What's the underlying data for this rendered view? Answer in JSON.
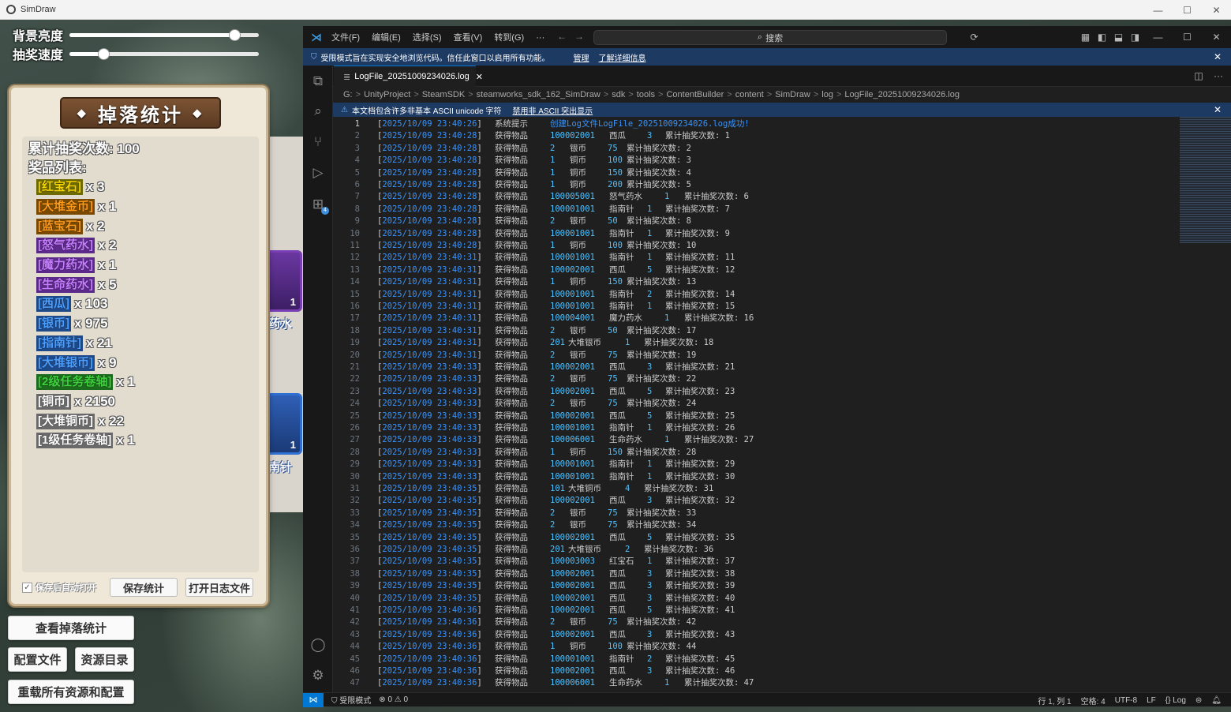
{
  "host": {
    "title": "SimDraw",
    "sliders": [
      {
        "label": "背景亮度",
        "value": 0.87
      },
      {
        "label": "抽奖速度",
        "value": 0.18
      }
    ],
    "drop_panel": {
      "title": "掉落统计",
      "total_label": "累计抽奖次数: 100",
      "list_label": "奖品列表:",
      "prizes": [
        {
          "name": "[红宝石]",
          "count": "x 3",
          "color": "#f5d400",
          "bg": "#6d6a00"
        },
        {
          "name": "[大堆金币]",
          "count": "x 1",
          "color": "#ff9a1a",
          "bg": "#7a4a00"
        },
        {
          "name": "[蓝宝石]",
          "count": "x 2",
          "color": "#ff9a1a",
          "bg": "#7a4a00"
        },
        {
          "name": "[怒气药水]",
          "count": "x 2",
          "color": "#c77dff",
          "bg": "#5b2a8a"
        },
        {
          "name": "[魔力药水]",
          "count": "x 1",
          "color": "#c77dff",
          "bg": "#5b2a8a"
        },
        {
          "name": "[生命药水]",
          "count": "x 5",
          "color": "#c77dff",
          "bg": "#5b2a8a"
        },
        {
          "name": "[西瓜]",
          "count": "x 103",
          "color": "#4d9fff",
          "bg": "#1f4a8a"
        },
        {
          "name": "[银币]",
          "count": "x 975",
          "color": "#4d9fff",
          "bg": "#1f4a8a"
        },
        {
          "name": "[指南针]",
          "count": "x 21",
          "color": "#4d9fff",
          "bg": "#1f4a8a"
        },
        {
          "name": "[大堆银币]",
          "count": "x 9",
          "color": "#4d9fff",
          "bg": "#1f4a8a"
        },
        {
          "name": "[2级任务卷轴]",
          "count": "x 1",
          "color": "#3fd23f",
          "bg": "#1d6b1d"
        },
        {
          "name": "[铜币]",
          "count": "x 2150",
          "color": "#ffffff",
          "bg": "#6a6a6a"
        },
        {
          "name": "[大堆铜币]",
          "count": "x 22",
          "color": "#ffffff",
          "bg": "#6a6a6a"
        },
        {
          "name": "[1级任务卷轴]",
          "count": "x 1",
          "color": "#ffffff",
          "bg": "#6a6a6a"
        }
      ],
      "auto_open_label": "保存后自动打开",
      "save_label": "保存统计",
      "open_log_label": "打开日志文件"
    },
    "card_labels": [
      "药水",
      "南针"
    ],
    "card_counts": [
      "1",
      "1"
    ],
    "buttons": {
      "view_stats": "查看掉落统计",
      "config_file": "配置文件",
      "resource_dir": "资源目录",
      "reload_all": "重载所有资源和配置"
    }
  },
  "vscode": {
    "menu": [
      "文件(F)",
      "编辑(E)",
      "选择(S)",
      "查看(V)",
      "转到(G)",
      "···"
    ],
    "search_placeholder": "搜索",
    "restricted_text": "受限模式旨在实现安全地浏览代码。信任此窗口以启用所有功能。",
    "restricted_manage": "管理",
    "restricted_learn": "了解详细信息",
    "tab_label": "LogFile_20251009234026.log",
    "breadcrumb": [
      "G:",
      "UnityProject",
      "SteamSDK",
      "steamworks_sdk_162_SimDraw",
      "sdk",
      "tools",
      "ContentBuilder",
      "content",
      "SimDraw",
      "log",
      "LogFile_20251009234026.log"
    ],
    "unicode_warning": "本文档包含许多非基本 ASCII unicode 字符",
    "unicode_disable": "禁用非 ASCII 突出显示",
    "lines": [
      {
        "n": "1",
        "ts": "2025/10/09 23:40:26",
        "kind": "系统提示",
        "msg": "创建Log文件LogFile_20251009234026.log成功!"
      },
      {
        "n": "2",
        "ts": "2025/10/09 23:40:28",
        "kind": "获得物品",
        "id": "100002001",
        "name": "西瓜",
        "qty": "3",
        "total": "累计抽奖次数: 1"
      },
      {
        "n": "3",
        "ts": "2025/10/09 23:40:28",
        "kind": "获得物品",
        "id": "2",
        "name": "银币",
        "qty": "75",
        "total": "累计抽奖次数: 2"
      },
      {
        "n": "4",
        "ts": "2025/10/09 23:40:28",
        "kind": "获得物品",
        "id": "1",
        "name": "铜币",
        "qty": "100",
        "total": "累计抽奖次数: 3"
      },
      {
        "n": "5",
        "ts": "2025/10/09 23:40:28",
        "kind": "获得物品",
        "id": "1",
        "name": "铜币",
        "qty": "150",
        "total": "累计抽奖次数: 4"
      },
      {
        "n": "6",
        "ts": "2025/10/09 23:40:28",
        "kind": "获得物品",
        "id": "1",
        "name": "铜币",
        "qty": "200",
        "total": "累计抽奖次数: 5"
      },
      {
        "n": "7",
        "ts": "2025/10/09 23:40:28",
        "kind": "获得物品",
        "id": "100005001",
        "name": "怒气药水",
        "qty": "1",
        "total": "累计抽奖次数: 6"
      },
      {
        "n": "8",
        "ts": "2025/10/09 23:40:28",
        "kind": "获得物品",
        "id": "100001001",
        "name": "指南针",
        "qty": "1",
        "total": "累计抽奖次数: 7"
      },
      {
        "n": "9",
        "ts": "2025/10/09 23:40:28",
        "kind": "获得物品",
        "id": "2",
        "name": "银币",
        "qty": "50",
        "total": "累计抽奖次数: 8"
      },
      {
        "n": "10",
        "ts": "2025/10/09 23:40:28",
        "kind": "获得物品",
        "id": "100001001",
        "name": "指南针",
        "qty": "1",
        "total": "累计抽奖次数: 9"
      },
      {
        "n": "11",
        "ts": "2025/10/09 23:40:28",
        "kind": "获得物品",
        "id": "1",
        "name": "铜币",
        "qty": "100",
        "total": "累计抽奖次数: 10"
      },
      {
        "n": "12",
        "ts": "2025/10/09 23:40:31",
        "kind": "获得物品",
        "id": "100001001",
        "name": "指南针",
        "qty": "1",
        "total": "累计抽奖次数: 11"
      },
      {
        "n": "13",
        "ts": "2025/10/09 23:40:31",
        "kind": "获得物品",
        "id": "100002001",
        "name": "西瓜",
        "qty": "5",
        "total": "累计抽奖次数: 12"
      },
      {
        "n": "14",
        "ts": "2025/10/09 23:40:31",
        "kind": "获得物品",
        "id": "1",
        "name": "铜币",
        "qty": "150",
        "total": "累计抽奖次数: 13"
      },
      {
        "n": "15",
        "ts": "2025/10/09 23:40:31",
        "kind": "获得物品",
        "id": "100001001",
        "name": "指南针",
        "qty": "2",
        "total": "累计抽奖次数: 14"
      },
      {
        "n": "16",
        "ts": "2025/10/09 23:40:31",
        "kind": "获得物品",
        "id": "100001001",
        "name": "指南针",
        "qty": "1",
        "total": "累计抽奖次数: 15"
      },
      {
        "n": "17",
        "ts": "2025/10/09 23:40:31",
        "kind": "获得物品",
        "id": "100004001",
        "name": "魔力药水",
        "qty": "1",
        "total": "累计抽奖次数: 16"
      },
      {
        "n": "18",
        "ts": "2025/10/09 23:40:31",
        "kind": "获得物品",
        "id": "2",
        "name": "银币",
        "qty": "50",
        "total": "累计抽奖次数: 17"
      },
      {
        "n": "19",
        "ts": "2025/10/09 23:40:31",
        "kind": "获得物品",
        "id": "201",
        "name": "大堆银币",
        "qty": "1",
        "total": "累计抽奖次数: 18"
      },
      {
        "n": "20",
        "ts": "2025/10/09 23:40:31",
        "kind": "获得物品",
        "id": "2",
        "name": "银币",
        "qty": "75",
        "total": "累计抽奖次数: 19"
      },
      {
        "n": "21",
        "ts": "2025/10/09 23:40:33",
        "kind": "获得物品",
        "id": "100002001",
        "name": "西瓜",
        "qty": "3",
        "total": "累计抽奖次数: 21"
      },
      {
        "n": "22",
        "ts": "2025/10/09 23:40:33",
        "kind": "获得物品",
        "id": "2",
        "name": "银币",
        "qty": "75",
        "total": "累计抽奖次数: 22"
      },
      {
        "n": "23",
        "ts": "2025/10/09 23:40:33",
        "kind": "获得物品",
        "id": "100002001",
        "name": "西瓜",
        "qty": "5",
        "total": "累计抽奖次数: 23"
      },
      {
        "n": "24",
        "ts": "2025/10/09 23:40:33",
        "kind": "获得物品",
        "id": "2",
        "name": "银币",
        "qty": "75",
        "total": "累计抽奖次数: 24"
      },
      {
        "n": "25",
        "ts": "2025/10/09 23:40:33",
        "kind": "获得物品",
        "id": "100002001",
        "name": "西瓜",
        "qty": "5",
        "total": "累计抽奖次数: 25"
      },
      {
        "n": "26",
        "ts": "2025/10/09 23:40:33",
        "kind": "获得物品",
        "id": "100001001",
        "name": "指南针",
        "qty": "1",
        "total": "累计抽奖次数: 26"
      },
      {
        "n": "27",
        "ts": "2025/10/09 23:40:33",
        "kind": "获得物品",
        "id": "100006001",
        "name": "生命药水",
        "qty": "1",
        "total": "累计抽奖次数: 27"
      },
      {
        "n": "28",
        "ts": "2025/10/09 23:40:33",
        "kind": "获得物品",
        "id": "1",
        "name": "铜币",
        "qty": "150",
        "total": "累计抽奖次数: 28"
      },
      {
        "n": "29",
        "ts": "2025/10/09 23:40:33",
        "kind": "获得物品",
        "id": "100001001",
        "name": "指南针",
        "qty": "1",
        "total": "累计抽奖次数: 29"
      },
      {
        "n": "30",
        "ts": "2025/10/09 23:40:33",
        "kind": "获得物品",
        "id": "100001001",
        "name": "指南针",
        "qty": "1",
        "total": "累计抽奖次数: 30"
      },
      {
        "n": "31",
        "ts": "2025/10/09 23:40:35",
        "kind": "获得物品",
        "id": "101",
        "name": "大堆铜币",
        "qty": "4",
        "total": "累计抽奖次数: 31"
      },
      {
        "n": "32",
        "ts": "2025/10/09 23:40:35",
        "kind": "获得物品",
        "id": "100002001",
        "name": "西瓜",
        "qty": "3",
        "total": "累计抽奖次数: 32"
      },
      {
        "n": "33",
        "ts": "2025/10/09 23:40:35",
        "kind": "获得物品",
        "id": "2",
        "name": "银币",
        "qty": "75",
        "total": "累计抽奖次数: 33"
      },
      {
        "n": "34",
        "ts": "2025/10/09 23:40:35",
        "kind": "获得物品",
        "id": "2",
        "name": "银币",
        "qty": "75",
        "total": "累计抽奖次数: 34"
      },
      {
        "n": "35",
        "ts": "2025/10/09 23:40:35",
        "kind": "获得物品",
        "id": "100002001",
        "name": "西瓜",
        "qty": "5",
        "total": "累计抽奖次数: 35"
      },
      {
        "n": "36",
        "ts": "2025/10/09 23:40:35",
        "kind": "获得物品",
        "id": "201",
        "name": "大堆银币",
        "qty": "2",
        "total": "累计抽奖次数: 36"
      },
      {
        "n": "37",
        "ts": "2025/10/09 23:40:35",
        "kind": "获得物品",
        "id": "100003003",
        "name": "红宝石",
        "qty": "1",
        "total": "累计抽奖次数: 37"
      },
      {
        "n": "38",
        "ts": "2025/10/09 23:40:35",
        "kind": "获得物品",
        "id": "100002001",
        "name": "西瓜",
        "qty": "3",
        "total": "累计抽奖次数: 38"
      },
      {
        "n": "39",
        "ts": "2025/10/09 23:40:35",
        "kind": "获得物品",
        "id": "100002001",
        "name": "西瓜",
        "qty": "3",
        "total": "累计抽奖次数: 39"
      },
      {
        "n": "40",
        "ts": "2025/10/09 23:40:35",
        "kind": "获得物品",
        "id": "100002001",
        "name": "西瓜",
        "qty": "3",
        "total": "累计抽奖次数: 40"
      },
      {
        "n": "41",
        "ts": "2025/10/09 23:40:36",
        "kind": "获得物品",
        "id": "100002001",
        "name": "西瓜",
        "qty": "5",
        "total": "累计抽奖次数: 41"
      },
      {
        "n": "42",
        "ts": "2025/10/09 23:40:36",
        "kind": "获得物品",
        "id": "2",
        "name": "银币",
        "qty": "75",
        "total": "累计抽奖次数: 42"
      },
      {
        "n": "43",
        "ts": "2025/10/09 23:40:36",
        "kind": "获得物品",
        "id": "100002001",
        "name": "西瓜",
        "qty": "3",
        "total": "累计抽奖次数: 43"
      },
      {
        "n": "44",
        "ts": "2025/10/09 23:40:36",
        "kind": "获得物品",
        "id": "1",
        "name": "铜币",
        "qty": "100",
        "total": "累计抽奖次数: 44"
      },
      {
        "n": "45",
        "ts": "2025/10/09 23:40:36",
        "kind": "获得物品",
        "id": "100001001",
        "name": "指南针",
        "qty": "2",
        "total": "累计抽奖次数: 45"
      },
      {
        "n": "46",
        "ts": "2025/10/09 23:40:36",
        "kind": "获得物品",
        "id": "100002001",
        "name": "西瓜",
        "qty": "3",
        "total": "累计抽奖次数: 46"
      },
      {
        "n": "47",
        "ts": "2025/10/09 23:40:36",
        "kind": "获得物品",
        "id": "100006001",
        "name": "生命药水",
        "qty": "1",
        "total": "累计抽奖次数: 47"
      }
    ],
    "status": {
      "restricted": "受限模式",
      "problems": "⊗ 0 ⚠ 0",
      "position": "行 1, 列 1",
      "spaces": "空格: 4",
      "encoding": "UTF-8",
      "eol": "LF",
      "language": "{} Log"
    }
  }
}
